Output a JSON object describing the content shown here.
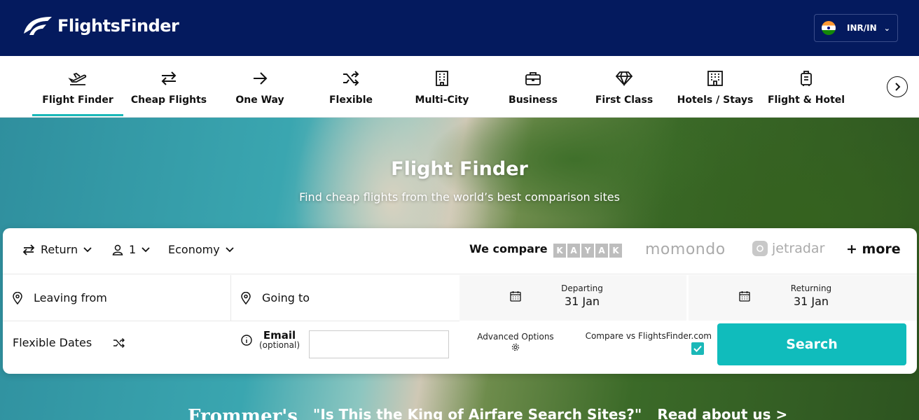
{
  "header": {
    "logo_text": "FlightsFinder",
    "currency": "INR/IN"
  },
  "nav": {
    "items": [
      {
        "label": "Flight Finder",
        "icon": "plane-takeoff-icon"
      },
      {
        "label": "Cheap Flights",
        "icon": "swap-arrows-icon"
      },
      {
        "label": "One Way",
        "icon": "arrow-right-icon"
      },
      {
        "label": "Flexible",
        "icon": "shuffle-icon"
      },
      {
        "label": "Multi-City",
        "icon": "building-icon"
      },
      {
        "label": "Business",
        "icon": "briefcase-icon"
      },
      {
        "label": "First Class",
        "icon": "diamond-icon"
      },
      {
        "label": "Hotels / Stays",
        "icon": "hotel-icon"
      },
      {
        "label": "Flight & Hotel",
        "icon": "luggage-icon"
      }
    ],
    "active_index": 0
  },
  "hero": {
    "title": "Flight Finder",
    "subtitle": "Find cheap flights from the world’s best comparison sites"
  },
  "search": {
    "trip_type": "Return",
    "passengers": "1",
    "cabin": "Economy",
    "we_compare": "We compare",
    "partners": [
      "KAYAK",
      "momondo",
      "jetradar"
    ],
    "more": "+ more",
    "leaving_placeholder": "Leaving from",
    "going_placeholder": "Going to",
    "departing_label": "Departing",
    "departing_value": "31 Jan",
    "returning_label": "Returning",
    "returning_value": "31 Jan",
    "flexible_dates": "Flexible Dates",
    "email_label": "Email",
    "email_optional": "(optional)",
    "email_value": "",
    "advanced_options": "Advanced Options",
    "compare_label": "Compare vs FlightsFinder.com",
    "compare_checked": true,
    "search_button": "Search"
  },
  "press": {
    "publication": "Frommer's",
    "quote": "\"Is This the King of Airfare Search Sites?\"",
    "link": "Read about us >"
  },
  "colors": {
    "header_bg": "#041a5e",
    "accent": "#10bcbc"
  }
}
